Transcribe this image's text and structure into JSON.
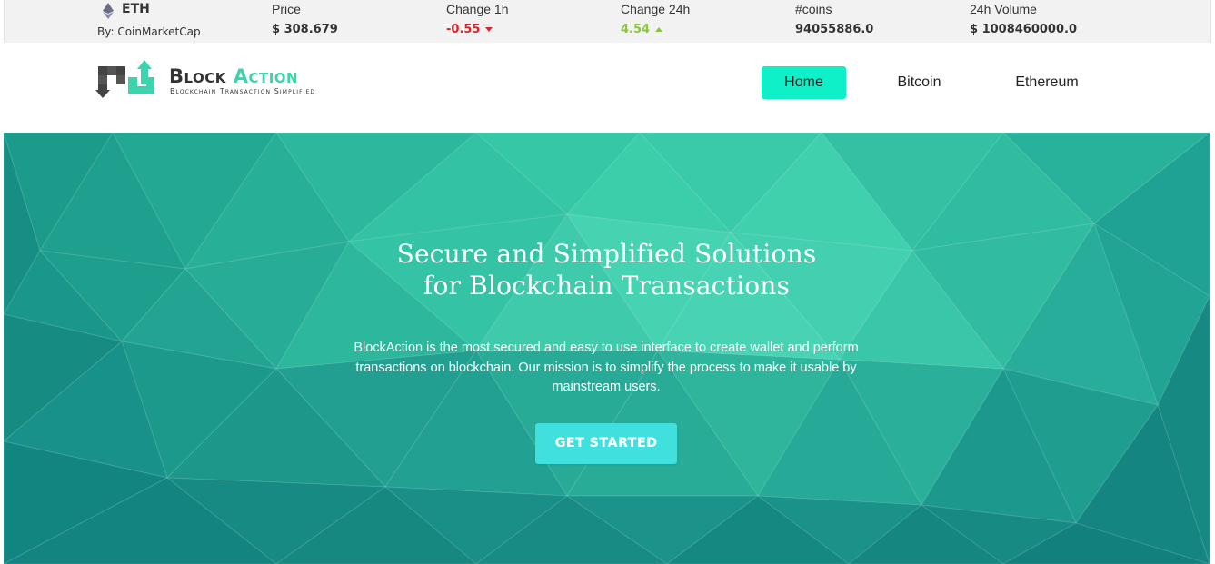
{
  "ticker": {
    "coin": {
      "symbol": "ETH",
      "source": "By: CoinMarketCap",
      "icon": "ethereum-icon"
    },
    "columns": [
      {
        "label": "Price",
        "value": "$ 308.679",
        "trend": "none"
      },
      {
        "label": "Change 1h",
        "value": "-0.55",
        "trend": "down"
      },
      {
        "label": "Change 24h",
        "value": "4.54",
        "trend": "up"
      },
      {
        "label": "#coins",
        "value": "94055886.0",
        "trend": "none"
      },
      {
        "label": "24h Volume",
        "value": "$ 1008460000.0",
        "trend": "none"
      }
    ],
    "colors": {
      "negative": "#d9262b",
      "positive": "#8cc63f"
    }
  },
  "header": {
    "brand": {
      "part1": "Block",
      "part2": "Action",
      "tagline": "Blockchain Transaction Simplified"
    },
    "nav": [
      {
        "label": "Home",
        "active": true
      },
      {
        "label": "Bitcoin",
        "active": false
      },
      {
        "label": "Ethereum",
        "active": false
      }
    ],
    "accent": "#0ff0c8"
  },
  "hero": {
    "title_line1": "Secure and Simplified Solutions",
    "title_line2": "for Blockchain Transactions",
    "description": "BlockAction is the most secured and easy to use interface to create wallet and perform transactions on blockchain. Our mission is to simplify the process to make it usable by mainstream users.",
    "cta_label": "GET STARTED",
    "colors": {
      "background": "#1fa595",
      "cta": "#3fe0dd"
    }
  }
}
